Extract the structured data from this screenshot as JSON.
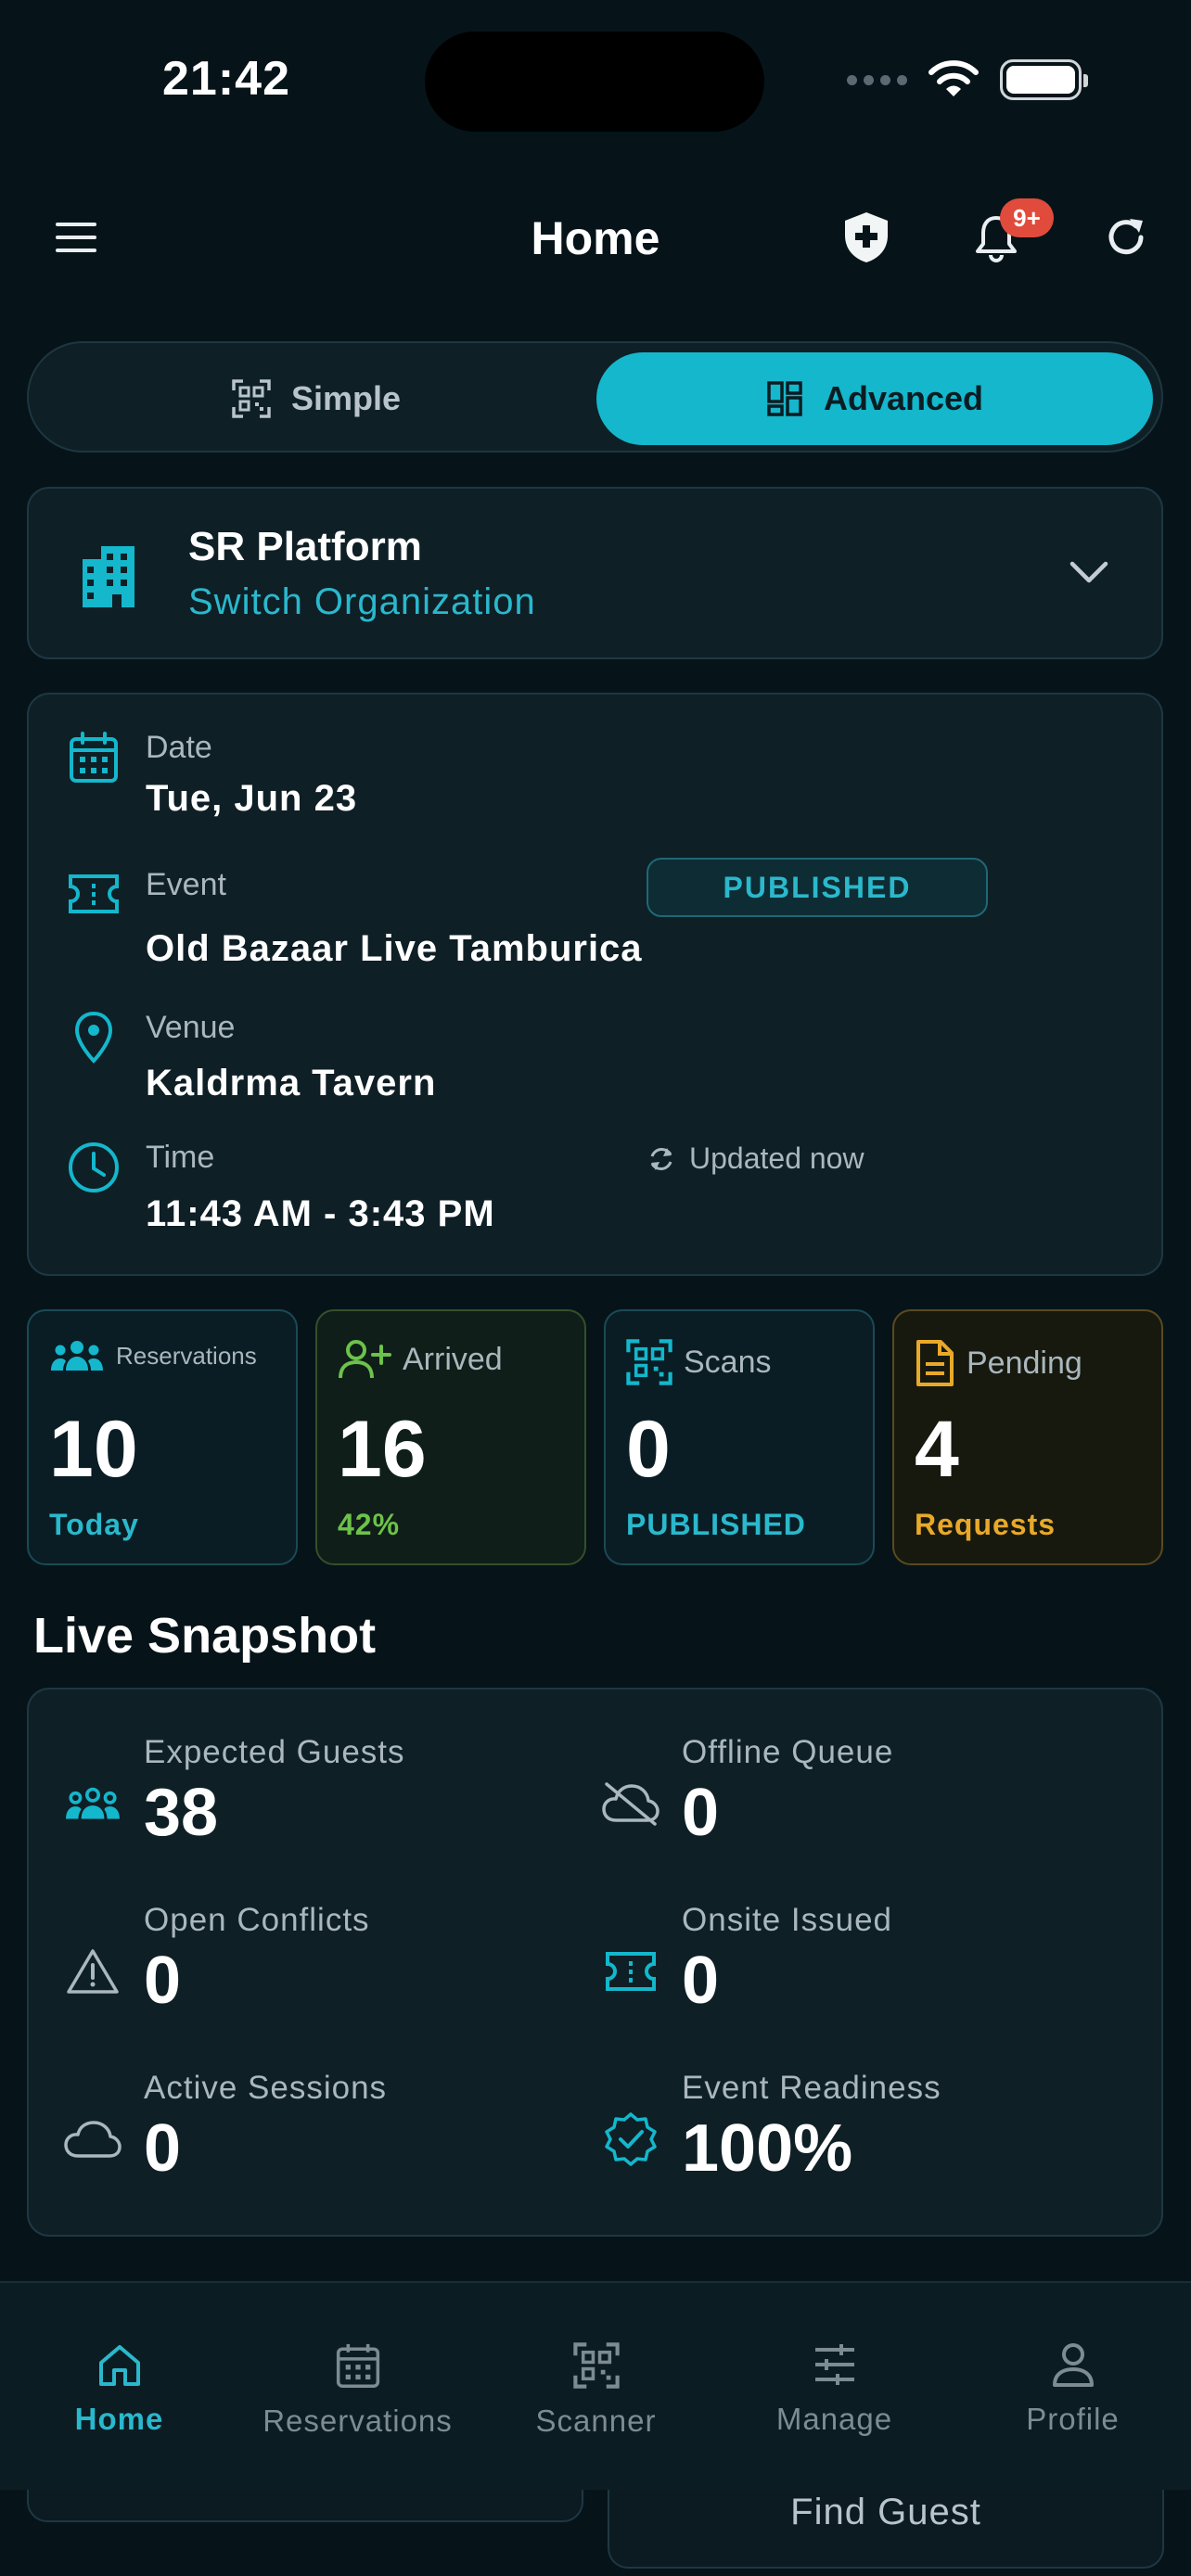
{
  "status_bar": {
    "time": "21:42"
  },
  "header": {
    "title": "Home",
    "notification_badge": "9+"
  },
  "view_toggle": {
    "simple_label": "Simple",
    "advanced_label": "Advanced",
    "selected": "Advanced"
  },
  "organization": {
    "name": "SR Platform",
    "switch_label": "Switch Organization"
  },
  "event": {
    "date_label": "Date",
    "date_value": "Tue, Jun 23",
    "event_label": "Event",
    "event_value": "Old Bazaar Live Tamburica",
    "status_badge": "PUBLISHED",
    "venue_label": "Venue",
    "venue_value": "Kaldrma Tavern",
    "time_label": "Time",
    "time_value": "11:43 AM - 3:43 PM",
    "updated_label": "Updated now"
  },
  "stats": [
    {
      "label": "Reservations",
      "value": "10",
      "sub": "Today",
      "color": "#2ab8cc"
    },
    {
      "label": "Arrived",
      "value": "16",
      "sub": "42%",
      "color": "#6cc24a"
    },
    {
      "label": "Scans",
      "value": "0",
      "sub": "PUBLISHED",
      "color": "#2ab8cc"
    },
    {
      "label": "Pending",
      "value": "4",
      "sub": "Requests",
      "color": "#e8a92a"
    }
  ],
  "snapshot": {
    "title": "Live Snapshot",
    "items": [
      {
        "label": "Expected Guests",
        "value": "38",
        "icon": "group-icon"
      },
      {
        "label": "Offline Queue",
        "value": "0",
        "icon": "cloud-off-icon"
      },
      {
        "label": "Open Conflicts",
        "value": "0",
        "icon": "warning-icon"
      },
      {
        "label": "Onsite Issued",
        "value": "0",
        "icon": "ticket-icon"
      },
      {
        "label": "Active Sessions",
        "value": "0",
        "icon": "cloud-icon"
      },
      {
        "label": "Event Readiness",
        "value": "100%",
        "icon": "verified-badge-icon"
      }
    ]
  },
  "find_guest_label": "Find Guest",
  "tabs": [
    {
      "label": "Home",
      "icon": "home-icon",
      "active": true
    },
    {
      "label": "Reservations",
      "icon": "calendar-icon",
      "active": false
    },
    {
      "label": "Scanner",
      "icon": "qr-scan-icon",
      "active": false
    },
    {
      "label": "Manage",
      "icon": "sliders-icon",
      "active": false
    },
    {
      "label": "Profile",
      "icon": "person-icon",
      "active": false
    }
  ],
  "colors": {
    "accent": "#14b7cc",
    "background": "#06141a",
    "card": "#0e1f26",
    "badge": "#e14b3c"
  }
}
